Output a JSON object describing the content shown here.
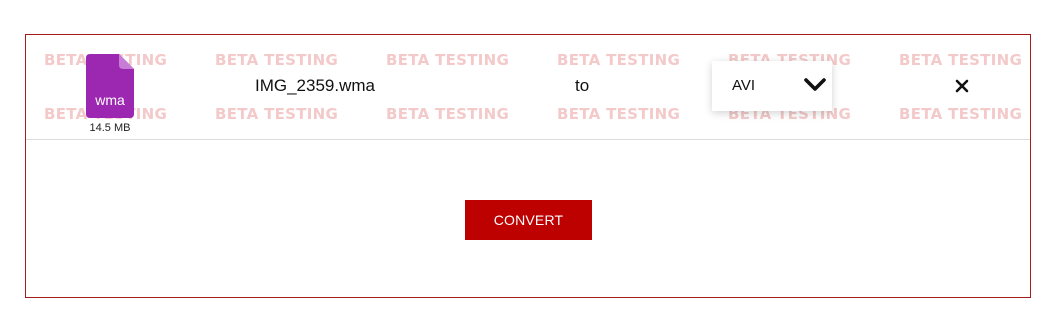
{
  "watermark_text": "BETA TESTING",
  "file": {
    "extension": "wma",
    "size": "14.5 MB",
    "name": "IMG_2359.wma",
    "icon": "wma-file-icon",
    "icon_color": "#9c27b0"
  },
  "conversion": {
    "to_label": "to",
    "target_format": "AVI",
    "dropdown_icon": "chevron-down-icon",
    "remove_icon": "close-icon"
  },
  "actions": {
    "convert_label": "CONVERT"
  },
  "colors": {
    "accent": "#bd0000",
    "border": "#a31b1b",
    "watermark": "#f3c9c9"
  }
}
